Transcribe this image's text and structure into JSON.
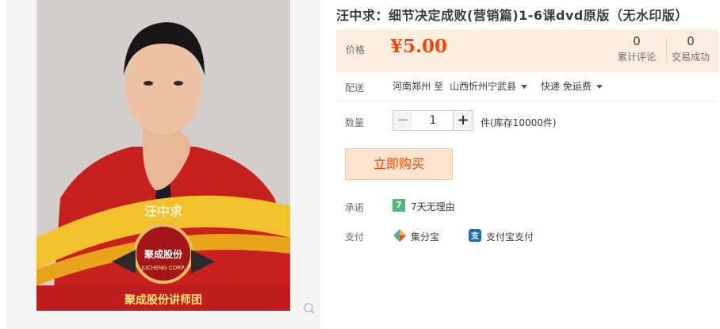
{
  "product": {
    "title": "汪中求：细节决定成败(营销篇)1-6课dvd原版（无水印版）",
    "image": {
      "banner_name": "汪中求",
      "badge_main": "聚成股份",
      "badge_sub": "JUCHENG CORP.",
      "ribbon_text": "聚成股份讲师团"
    }
  },
  "price": {
    "label": "价格",
    "value": "¥5.00",
    "reviews_count": "0",
    "reviews_label": "累计评论",
    "sales_count": "0",
    "sales_label": "交易成功"
  },
  "shipping": {
    "label": "配送",
    "from": "河南郑州",
    "to_word": "至",
    "destination": "山西忻州宁武县",
    "method": "快递 免运费"
  },
  "quantity": {
    "label": "数量",
    "minus": "−",
    "value": "1",
    "plus": "+",
    "stock": "件(库存10000件)"
  },
  "buy": {
    "label": "立即购买"
  },
  "promise": {
    "label": "承诺",
    "badge": "7",
    "text": "7天无理由"
  },
  "payment": {
    "label": "支付",
    "methods": [
      "集分宝",
      "支付宝支付"
    ]
  },
  "colors": {
    "price": "#ff4400",
    "price_panel_bg": "#fbeee0",
    "buy_bg": "#ffe4d0",
    "promise_green": "#4cb87b"
  }
}
